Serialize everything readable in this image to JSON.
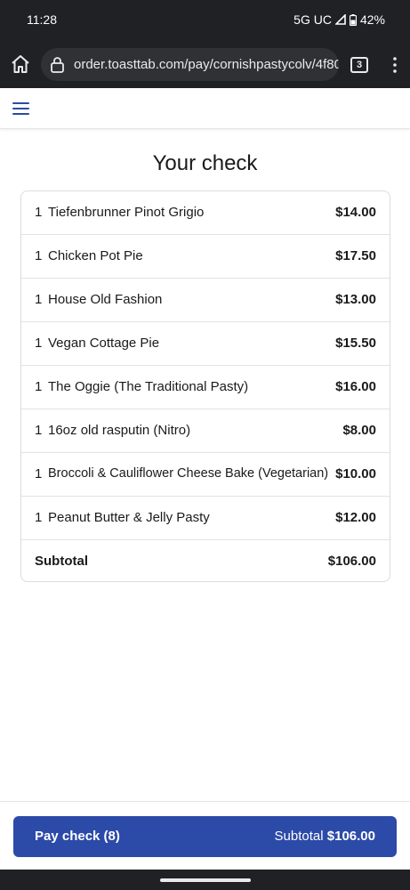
{
  "status_bar": {
    "time": "11:28",
    "network": "5G UC",
    "battery": "42%"
  },
  "browser": {
    "url": "order.toasttab.com/pay/cornishpastycolv/4f80",
    "tab_count": "3"
  },
  "page": {
    "title": "Your check"
  },
  "check": {
    "items": [
      {
        "qty": "1",
        "name": "Tiefenbrunner Pinot Grigio",
        "price": "$14.00"
      },
      {
        "qty": "1",
        "name": "Chicken Pot Pie",
        "price": "$17.50"
      },
      {
        "qty": "1",
        "name": "House Old Fashion",
        "price": "$13.00"
      },
      {
        "qty": "1",
        "name": "Vegan Cottage Pie",
        "price": "$15.50"
      },
      {
        "qty": "1",
        "name": "The Oggie (The Traditional Pasty)",
        "price": "$16.00"
      },
      {
        "qty": "1",
        "name": "16oz old rasputin (Nitro)",
        "price": "$8.00"
      },
      {
        "qty": "1",
        "name": "Broccoli & Cauliflower Cheese Bake (Vegetarian)",
        "price": "$10.00"
      },
      {
        "qty": "1",
        "name": "Peanut Butter & Jelly Pasty",
        "price": "$12.00"
      }
    ],
    "subtotal_label": "Subtotal",
    "subtotal_value": "$106.00"
  },
  "footer": {
    "pay_label": "Pay check (8)",
    "subtotal_label": "Subtotal",
    "subtotal_value": "$106.00"
  },
  "colors": {
    "accent": "#2c4aa8",
    "browser_chrome": "#202124"
  }
}
